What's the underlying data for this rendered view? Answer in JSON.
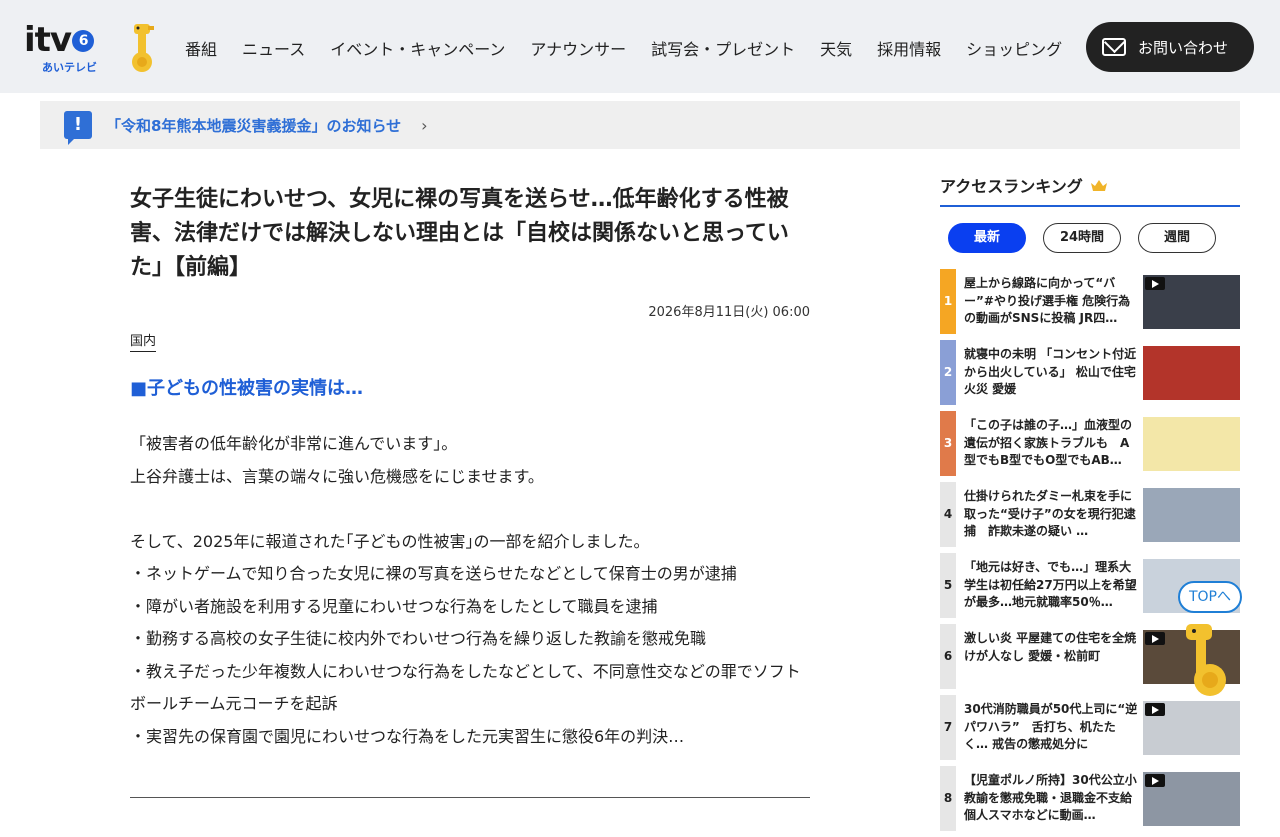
{
  "header": {
    "logo_text": "itv",
    "logo_badge": "6",
    "logo_sub": "あいテレビ",
    "nav": [
      "番組",
      "ニュース",
      "イベント・キャンペーン",
      "アナウンサー",
      "試写会・プレゼント",
      "天気",
      "採用情報",
      "ショッピング"
    ],
    "contact_label": "お問い合わせ"
  },
  "notice": {
    "icon": "!",
    "text": "「令和8年熊本地震災害義援金」のお知らせ",
    "chevron": "›"
  },
  "article": {
    "title": "女子生徒にわいせつ、女児に裸の写真を送らせ…低年齢化する性被害、法律だけでは解決しない理由とは「自校は関係ないと思っていた」【前編】",
    "date": "2026年8月11日(火) 06:00",
    "category": "国内",
    "subhead": "■子どもの性被害の実情は…",
    "paragraphs": [
      "「被害者の低年齢化が非常に進んでいます」。",
      "上谷弁護士は、言葉の端々に強い危機感をにじませます。",
      "",
      "そして、2025年に報道された｢子どもの性被害｣の一部を紹介しました。",
      "・ネットゲームで知り合った女児に裸の写真を送らせたなどとして保育士の男が逮捕",
      "・障がい者施設を利用する児童にわいせつな行為をしたとして職員を逮捕",
      "・勤務する高校の女子生徒に校内外でわいせつ行為を繰り返した教諭を懲戒免職",
      "・教え子だった少年複数人にわいせつな行為をしたなどとして、不同意性交などの罪でソフトボールチーム元コーチを起訴",
      "・実習先の保育園で園児にわいせつな行為をした元実習生に懲役6年の判決…"
    ]
  },
  "sidebar": {
    "heading": "アクセスランキング",
    "tabs": [
      "最新",
      "24時間",
      "週間"
    ],
    "active_tab": "最新",
    "rankings": [
      {
        "rank": "1",
        "text": "屋上から線路に向かって“バー”#やり投げ選手権 危険行為の動画がSNSに投稿 JR四…",
        "color": "#f5a623",
        "video": true,
        "thumb": "#3a3f4a"
      },
      {
        "rank": "2",
        "text": "就寝中の未明 「コンセント付近から出火している」 松山で住宅火災 愛媛",
        "color": "#8a9fd6",
        "video": false,
        "thumb": "#b3342a"
      },
      {
        "rank": "3",
        "text": "「この子は誰の子…」血液型の遺伝が招く家族トラブルも　A型でもB型でもO型でもAB…",
        "color": "#e07a4a",
        "video": false,
        "thumb": "#f3e7a8"
      },
      {
        "rank": "4",
        "text": "仕掛けられたダミー札束を手に取った“受け子”の女を現行犯逮捕　詐欺未遂の疑い …",
        "color": "#e6e6e6",
        "video": false,
        "thumb": "#9aa7b8"
      },
      {
        "rank": "5",
        "text": "「地元は好き、でも…」理系大学生は初任給27万円以上を希望が最多…地元就職率50％…",
        "color": "#e6e6e6",
        "video": false,
        "thumb": "#c9d2dc"
      },
      {
        "rank": "6",
        "text": "激しい炎 平屋建ての住宅を全焼けが人なし 愛媛・松前町",
        "color": "#e6e6e6",
        "video": true,
        "thumb": "#5a4a3a"
      },
      {
        "rank": "7",
        "text": "30代消防職員が50代上司に“逆パワハラ”　舌打ち、机たたく… 戒告の懲戒処分に",
        "color": "#e6e6e6",
        "video": true,
        "thumb": "#c8ccd2"
      },
      {
        "rank": "8",
        "text": "【児童ポルノ所持】30代公立小教諭を懲戒免職・退職金不支給個人スマホなどに動画…",
        "color": "#e6e6e6",
        "video": true,
        "thumb": "#8d96a3"
      }
    ]
  },
  "top_button": "TOPへ"
}
